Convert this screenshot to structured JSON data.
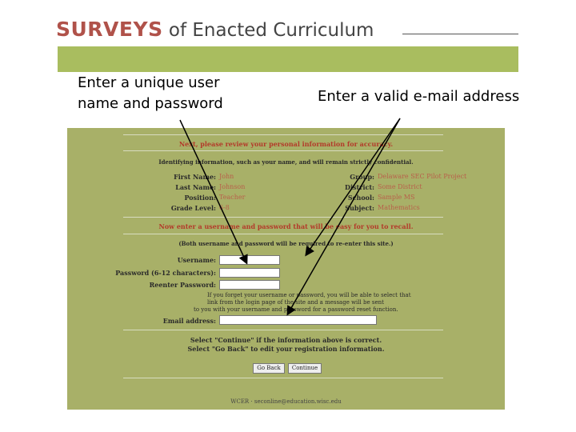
{
  "header": {
    "brand_strong": "SURVEYS",
    "brand_light": " of Enacted Curriculum",
    "accent_color": "#b0524a",
    "bar_color": "#a9bd5f"
  },
  "callouts": {
    "left_line1": "Enter a unique user",
    "left_line2": "name and password",
    "right": "Enter a valid e-mail address"
  },
  "form": {
    "review_heading": "Next, please review your personal information for accuracy.",
    "confidential_note": "Identifying information, such as your name, and will remain strictly confidential.",
    "personal_info": [
      {
        "label": "First Name:",
        "value": "John"
      },
      {
        "label": "Last Name:",
        "value": "Johnson"
      },
      {
        "label": "Position:",
        "value": "Teacher"
      },
      {
        "label": "Grade Level:",
        "value": "6-8"
      }
    ],
    "school_info": [
      {
        "label": "Group:",
        "value": "Delaware SEC Pilot Project"
      },
      {
        "label": "District:",
        "value": "Some District"
      },
      {
        "label": "School:",
        "value": "Sample MS"
      },
      {
        "label": "Subject:",
        "value": "Mathematics"
      }
    ],
    "credentials_heading": "Now enter a username and password that will be easy for you to recall.",
    "credentials_note": "(Both username and password will be required to re-enter this site.)",
    "username_label": "Username:",
    "password_label": "Password (6-12 characters):",
    "reenter_label": "Reenter Password:",
    "help_line1": "If you forget your username or password, you will be able to select that",
    "help_line2": "link from the login page of the site and a message will be sent",
    "help_line3": "to you with your username and password for a password reset function.",
    "email_label": "Email address:",
    "continue_line1": "Select \"Continue\" if the information above is correct.",
    "continue_line2": "Select \"Go Back\" to edit your registration information.",
    "go_back_label": "Go Back",
    "continue_label": "Continue",
    "footer": "WCER · seconline@education.wisc.edu"
  }
}
